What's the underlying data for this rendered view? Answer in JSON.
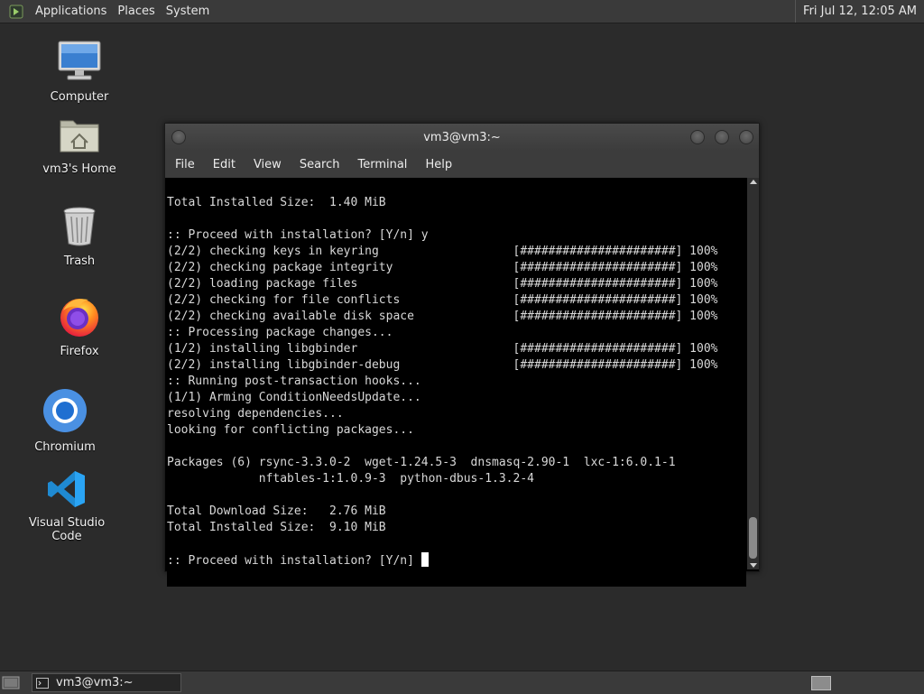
{
  "top_panel": {
    "menus": [
      "Applications",
      "Places",
      "System"
    ],
    "clock": "Fri Jul 12, 12:05 AM"
  },
  "desktop_icons": [
    {
      "label": "Computer",
      "icon": "computer-icon"
    },
    {
      "label": "vm3's Home",
      "icon": "home-folder-icon"
    },
    {
      "label": "Trash",
      "icon": "trash-icon"
    },
    {
      "label": "Firefox",
      "icon": "firefox-icon"
    },
    {
      "label": "Chromium",
      "icon": "chromium-icon"
    },
    {
      "label": "Visual Studio Code",
      "icon": "vscode-icon"
    }
  ],
  "terminal": {
    "title": "vm3@vm3:~",
    "menu": [
      "File",
      "Edit",
      "View",
      "Search",
      "Terminal",
      "Help"
    ],
    "lines": [
      "Total Installed Size:  1.40 MiB",
      "",
      ":: Proceed with installation? [Y/n] y",
      "(2/2) checking keys in keyring                   [######################] 100%",
      "(2/2) checking package integrity                 [######################] 100%",
      "(2/2) loading package files                      [######################] 100%",
      "(2/2) checking for file conflicts                [######################] 100%",
      "(2/2) checking available disk space              [######################] 100%",
      ":: Processing package changes...",
      "(1/2) installing libgbinder                      [######################] 100%",
      "(2/2) installing libgbinder-debug                [######################] 100%",
      ":: Running post-transaction hooks...",
      "(1/1) Arming ConditionNeedsUpdate...",
      "resolving dependencies...",
      "looking for conflicting packages...",
      "",
      "Packages (6) rsync-3.3.0-2  wget-1.24.5-3  dnsmasq-2.90-1  lxc-1:6.0.1-1",
      "             nftables-1:1.0.9-3  python-dbus-1.3.2-4",
      "",
      "Total Download Size:   2.76 MiB",
      "Total Installed Size:  9.10 MiB",
      ""
    ],
    "prompt": ":: Proceed with installation? [Y/n] "
  },
  "taskbar": {
    "task_label": "vm3@vm3:~"
  }
}
